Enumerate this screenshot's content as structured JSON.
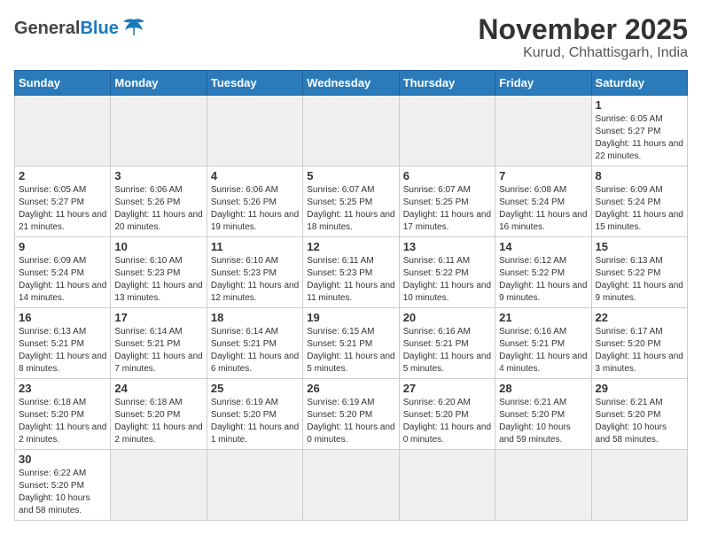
{
  "header": {
    "logo_general": "General",
    "logo_blue": "Blue",
    "title": "November 2025",
    "subtitle": "Kurud, Chhattisgarh, India"
  },
  "weekdays": [
    "Sunday",
    "Monday",
    "Tuesday",
    "Wednesday",
    "Thursday",
    "Friday",
    "Saturday"
  ],
  "days": [
    {
      "date": "",
      "empty": true
    },
    {
      "date": "",
      "empty": true
    },
    {
      "date": "",
      "empty": true
    },
    {
      "date": "",
      "empty": true
    },
    {
      "date": "",
      "empty": true
    },
    {
      "date": "",
      "empty": true
    },
    {
      "date": "1",
      "sunrise": "Sunrise: 6:05 AM",
      "sunset": "Sunset: 5:27 PM",
      "daylight": "Daylight: 11 hours and 22 minutes."
    },
    {
      "date": "2",
      "sunrise": "Sunrise: 6:05 AM",
      "sunset": "Sunset: 5:27 PM",
      "daylight": "Daylight: 11 hours and 21 minutes."
    },
    {
      "date": "3",
      "sunrise": "Sunrise: 6:06 AM",
      "sunset": "Sunset: 5:26 PM",
      "daylight": "Daylight: 11 hours and 20 minutes."
    },
    {
      "date": "4",
      "sunrise": "Sunrise: 6:06 AM",
      "sunset": "Sunset: 5:26 PM",
      "daylight": "Daylight: 11 hours and 19 minutes."
    },
    {
      "date": "5",
      "sunrise": "Sunrise: 6:07 AM",
      "sunset": "Sunset: 5:25 PM",
      "daylight": "Daylight: 11 hours and 18 minutes."
    },
    {
      "date": "6",
      "sunrise": "Sunrise: 6:07 AM",
      "sunset": "Sunset: 5:25 PM",
      "daylight": "Daylight: 11 hours and 17 minutes."
    },
    {
      "date": "7",
      "sunrise": "Sunrise: 6:08 AM",
      "sunset": "Sunset: 5:24 PM",
      "daylight": "Daylight: 11 hours and 16 minutes."
    },
    {
      "date": "8",
      "sunrise": "Sunrise: 6:09 AM",
      "sunset": "Sunset: 5:24 PM",
      "daylight": "Daylight: 11 hours and 15 minutes."
    },
    {
      "date": "9",
      "sunrise": "Sunrise: 6:09 AM",
      "sunset": "Sunset: 5:24 PM",
      "daylight": "Daylight: 11 hours and 14 minutes."
    },
    {
      "date": "10",
      "sunrise": "Sunrise: 6:10 AM",
      "sunset": "Sunset: 5:23 PM",
      "daylight": "Daylight: 11 hours and 13 minutes."
    },
    {
      "date": "11",
      "sunrise": "Sunrise: 6:10 AM",
      "sunset": "Sunset: 5:23 PM",
      "daylight": "Daylight: 11 hours and 12 minutes."
    },
    {
      "date": "12",
      "sunrise": "Sunrise: 6:11 AM",
      "sunset": "Sunset: 5:23 PM",
      "daylight": "Daylight: 11 hours and 11 minutes."
    },
    {
      "date": "13",
      "sunrise": "Sunrise: 6:11 AM",
      "sunset": "Sunset: 5:22 PM",
      "daylight": "Daylight: 11 hours and 10 minutes."
    },
    {
      "date": "14",
      "sunrise": "Sunrise: 6:12 AM",
      "sunset": "Sunset: 5:22 PM",
      "daylight": "Daylight: 11 hours and 9 minutes."
    },
    {
      "date": "15",
      "sunrise": "Sunrise: 6:13 AM",
      "sunset": "Sunset: 5:22 PM",
      "daylight": "Daylight: 11 hours and 9 minutes."
    },
    {
      "date": "16",
      "sunrise": "Sunrise: 6:13 AM",
      "sunset": "Sunset: 5:21 PM",
      "daylight": "Daylight: 11 hours and 8 minutes."
    },
    {
      "date": "17",
      "sunrise": "Sunrise: 6:14 AM",
      "sunset": "Sunset: 5:21 PM",
      "daylight": "Daylight: 11 hours and 7 minutes."
    },
    {
      "date": "18",
      "sunrise": "Sunrise: 6:14 AM",
      "sunset": "Sunset: 5:21 PM",
      "daylight": "Daylight: 11 hours and 6 minutes."
    },
    {
      "date": "19",
      "sunrise": "Sunrise: 6:15 AM",
      "sunset": "Sunset: 5:21 PM",
      "daylight": "Daylight: 11 hours and 5 minutes."
    },
    {
      "date": "20",
      "sunrise": "Sunrise: 6:16 AM",
      "sunset": "Sunset: 5:21 PM",
      "daylight": "Daylight: 11 hours and 5 minutes."
    },
    {
      "date": "21",
      "sunrise": "Sunrise: 6:16 AM",
      "sunset": "Sunset: 5:21 PM",
      "daylight": "Daylight: 11 hours and 4 minutes."
    },
    {
      "date": "22",
      "sunrise": "Sunrise: 6:17 AM",
      "sunset": "Sunset: 5:20 PM",
      "daylight": "Daylight: 11 hours and 3 minutes."
    },
    {
      "date": "23",
      "sunrise": "Sunrise: 6:18 AM",
      "sunset": "Sunset: 5:20 PM",
      "daylight": "Daylight: 11 hours and 2 minutes."
    },
    {
      "date": "24",
      "sunrise": "Sunrise: 6:18 AM",
      "sunset": "Sunset: 5:20 PM",
      "daylight": "Daylight: 11 hours and 2 minutes."
    },
    {
      "date": "25",
      "sunrise": "Sunrise: 6:19 AM",
      "sunset": "Sunset: 5:20 PM",
      "daylight": "Daylight: 11 hours and 1 minute."
    },
    {
      "date": "26",
      "sunrise": "Sunrise: 6:19 AM",
      "sunset": "Sunset: 5:20 PM",
      "daylight": "Daylight: 11 hours and 0 minutes."
    },
    {
      "date": "27",
      "sunrise": "Sunrise: 6:20 AM",
      "sunset": "Sunset: 5:20 PM",
      "daylight": "Daylight: 11 hours and 0 minutes."
    },
    {
      "date": "28",
      "sunrise": "Sunrise: 6:21 AM",
      "sunset": "Sunset: 5:20 PM",
      "daylight": "Daylight: 10 hours and 59 minutes."
    },
    {
      "date": "29",
      "sunrise": "Sunrise: 6:21 AM",
      "sunset": "Sunset: 5:20 PM",
      "daylight": "Daylight: 10 hours and 58 minutes."
    },
    {
      "date": "30",
      "sunrise": "Sunrise: 6:22 AM",
      "sunset": "Sunset: 5:20 PM",
      "daylight": "Daylight: 10 hours and 58 minutes."
    },
    {
      "date": "",
      "empty": true
    },
    {
      "date": "",
      "empty": true
    },
    {
      "date": "",
      "empty": true
    },
    {
      "date": "",
      "empty": true
    },
    {
      "date": "",
      "empty": true
    },
    {
      "date": "",
      "empty": true
    }
  ]
}
